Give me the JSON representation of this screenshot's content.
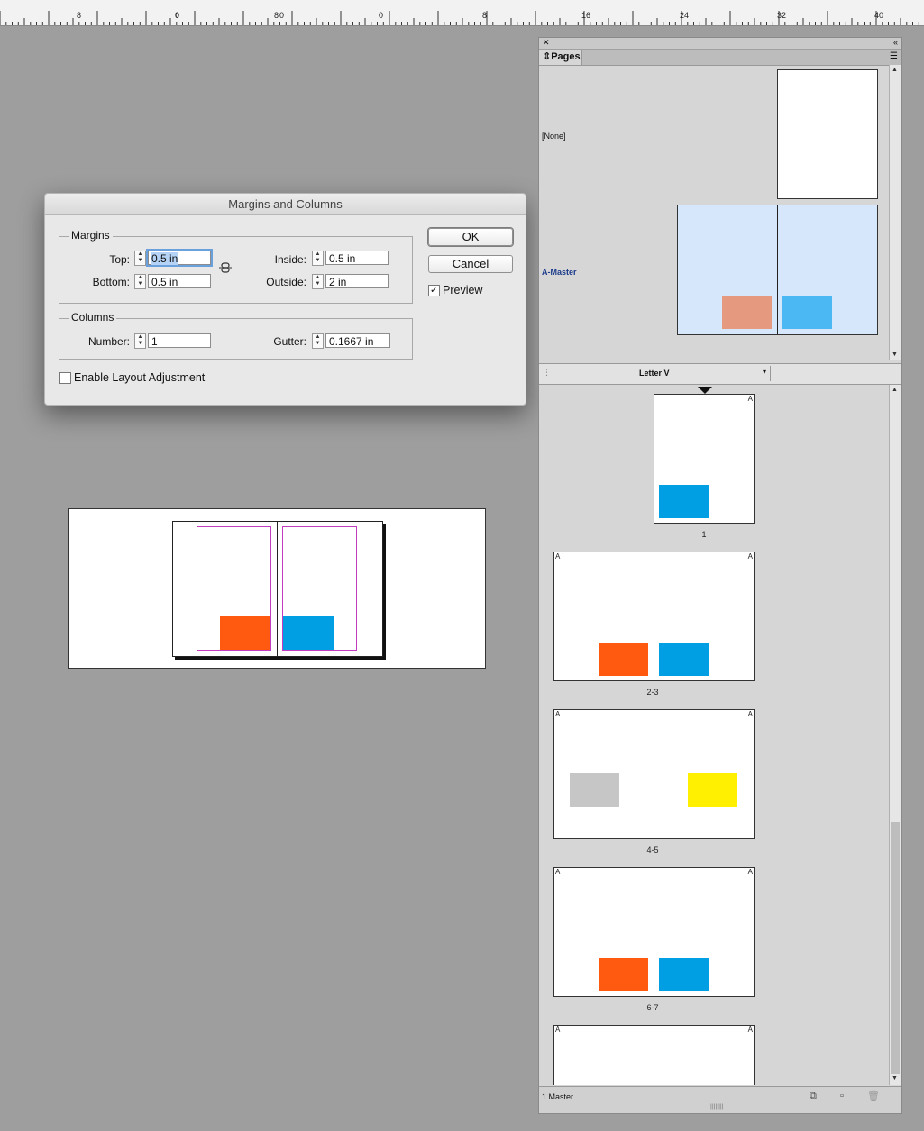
{
  "ruler": {
    "labels": [
      "8",
      "0",
      "8",
      "0",
      "0",
      "8",
      "16",
      "24",
      "32",
      "40"
    ]
  },
  "dialog": {
    "title": "Margins and Columns",
    "margins": {
      "legend": "Margins",
      "top_label": "Top:",
      "top_value": "0.5 in",
      "bottom_label": "Bottom:",
      "bottom_value": "0.5 in",
      "inside_label": "Inside:",
      "inside_value": "0.5 in",
      "outside_label": "Outside:",
      "outside_value": "2 in"
    },
    "columns": {
      "legend": "Columns",
      "number_label": "Number:",
      "number_value": "1",
      "gutter_label": "Gutter:",
      "gutter_value": "0.1667 in"
    },
    "ok_label": "OK",
    "cancel_label": "Cancel",
    "preview_label": "Preview",
    "preview_checked": true,
    "enable_layout_label": "Enable Layout Adjustment",
    "enable_layout_checked": false
  },
  "panel": {
    "tab_label": "Pages",
    "masters": [
      {
        "name": "[None]"
      },
      {
        "name": "A-Master"
      }
    ],
    "size_dropdown": "Letter V",
    "page_labels": [
      "1",
      "2-3",
      "4-5",
      "6-7"
    ],
    "master_letter": "A",
    "footer_status": "1 Master"
  },
  "colors": {
    "orange": "#ff5a0f",
    "blue": "#009fe3",
    "gray": "#c6c6c6",
    "yellow": "#ffef00",
    "master_bg": "#d6e6fb",
    "master_orange": "#e59a7f",
    "master_blue": "#4cb8f3",
    "margin_guide": "#c23cc2"
  }
}
